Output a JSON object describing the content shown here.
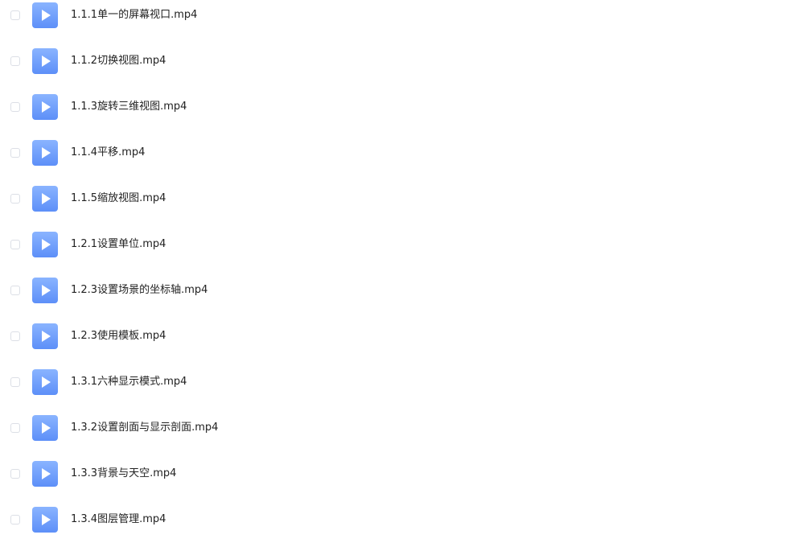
{
  "files": [
    {
      "name": "1.1.1单一的屏幕视口.mp4",
      "icon": "video-play-icon"
    },
    {
      "name": "1.1.2切换视图.mp4",
      "icon": "video-play-icon"
    },
    {
      "name": "1.1.3旋转三维视图.mp4",
      "icon": "video-play-icon"
    },
    {
      "name": "1.1.4平移.mp4",
      "icon": "video-play-icon"
    },
    {
      "name": "1.1.5缩放视图.mp4",
      "icon": "video-play-icon"
    },
    {
      "name": "1.2.1设置单位.mp4",
      "icon": "video-play-icon"
    },
    {
      "name": "1.2.3设置场景的坐标轴.mp4",
      "icon": "video-play-icon"
    },
    {
      "name": "1.2.3使用模板.mp4",
      "icon": "video-play-icon"
    },
    {
      "name": "1.3.1六种显示模式.mp4",
      "icon": "video-play-icon"
    },
    {
      "name": "1.3.2设置剖面与显示剖面.mp4",
      "icon": "video-play-icon"
    },
    {
      "name": "1.3.3背景与天空.mp4",
      "icon": "video-play-icon"
    },
    {
      "name": "1.3.4图层管理.mp4",
      "icon": "video-play-icon"
    }
  ],
  "colors": {
    "icon_gradient_top": "#8ab4ff",
    "icon_gradient_bottom": "#5d8ff8",
    "checkbox_border": "#dcdfe6",
    "text": "#222222"
  }
}
